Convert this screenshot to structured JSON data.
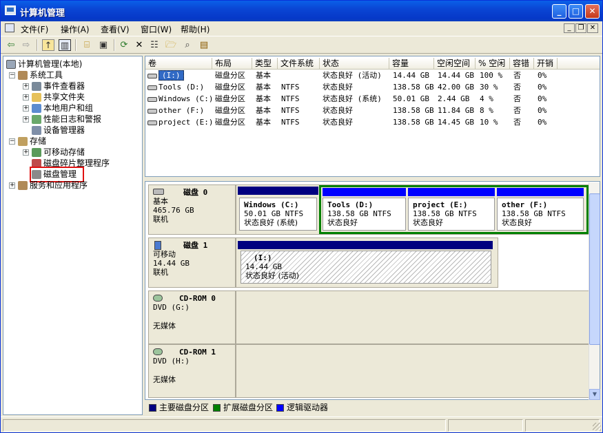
{
  "window": {
    "title": "计算机管理"
  },
  "menu": [
    "文件(F)",
    "操作(A)",
    "查看(V)",
    "窗口(W)",
    "帮助(H)"
  ],
  "toolbar": {
    "icons": [
      "back-icon",
      "forward-icon",
      "up-icon",
      "show-hide-tree-icon",
      "properties-icon",
      "help-icon",
      "refresh-icon",
      "delete-icon",
      "properties2-icon",
      "open-icon",
      "search-icon",
      "export-icon"
    ]
  },
  "tree": {
    "root": "计算机管理(本地)",
    "system_tools": "系统工具",
    "event_viewer": "事件查看器",
    "shared_folders": "共享文件夹",
    "local_users": "本地用户和组",
    "perf_logs": "性能日志和警报",
    "device_manager": "设备管理器",
    "storage": "存储",
    "removable_storage": "可移动存储",
    "defrag": "磁盘碎片整理程序",
    "disk_management": "磁盘管理",
    "services": "服务和应用程序"
  },
  "volumes": {
    "columns": [
      "卷",
      "布局",
      "类型",
      "文件系统",
      "状态",
      "容量",
      "空闲空间",
      "% 空闲",
      "容错",
      "开销"
    ],
    "rows": [
      {
        "vol": "(I:)",
        "layout": "磁盘分区",
        "type": "基本",
        "fs": "",
        "status": "状态良好 (活动)",
        "cap": "14.44 GB",
        "free": "14.44 GB",
        "pct": "100 %",
        "ft": "否",
        "ovh": "0%"
      },
      {
        "vol": "Tools (D:)",
        "layout": "磁盘分区",
        "type": "基本",
        "fs": "NTFS",
        "status": "状态良好",
        "cap": "138.58 GB",
        "free": "42.00 GB",
        "pct": "30 %",
        "ft": "否",
        "ovh": "0%"
      },
      {
        "vol": "Windows (C:)",
        "layout": "磁盘分区",
        "type": "基本",
        "fs": "NTFS",
        "status": "状态良好 (系统)",
        "cap": "50.01 GB",
        "free": "2.44 GB",
        "pct": "4 %",
        "ft": "否",
        "ovh": "0%"
      },
      {
        "vol": "other (F:)",
        "layout": "磁盘分区",
        "type": "基本",
        "fs": "NTFS",
        "status": "状态良好",
        "cap": "138.58 GB",
        "free": "11.84 GB",
        "pct": "8 %",
        "ft": "否",
        "ovh": "0%"
      },
      {
        "vol": "project (E:)",
        "layout": "磁盘分区",
        "type": "基本",
        "fs": "NTFS",
        "status": "状态良好",
        "cap": "138.58 GB",
        "free": "14.45 GB",
        "pct": "10 %",
        "ft": "否",
        "ovh": "0%"
      }
    ]
  },
  "disks": {
    "disk0": {
      "name": "磁盘 0",
      "type": "基本",
      "size": "465.76 GB",
      "state": "联机",
      "parts": [
        {
          "name": "Windows  (C:)",
          "info": "50.01 GB NTFS",
          "status": "状态良好 (系统)"
        },
        {
          "name": "Tools  (D:)",
          "info": "138.58 GB NTFS",
          "status": "状态良好"
        },
        {
          "name": "project  (E:)",
          "info": "138.58 GB NTFS",
          "status": "状态良好"
        },
        {
          "name": "other  (F:)",
          "info": "138.58 GB NTFS",
          "status": "状态良好"
        }
      ]
    },
    "disk1": {
      "name": "磁盘 1",
      "type": "可移动",
      "size": "14.44 GB",
      "state": "联机",
      "part": {
        "name": "(I:)",
        "info": "14.44 GB",
        "status": "状态良好 (活动)"
      }
    },
    "cdrom0": {
      "name": "CD-ROM 0",
      "drive": "DVD (G:)",
      "media": "无媒体"
    },
    "cdrom1": {
      "name": "CD-ROM 1",
      "drive": "DVD (H:)",
      "media": "无媒体"
    }
  },
  "legend": {
    "primary": "主要磁盘分区",
    "extended": "扩展磁盘分区",
    "logical": "逻辑驱动器"
  },
  "colors": {
    "primary": "#000080",
    "extended": "#008000",
    "logical": "#0000ff",
    "titlebar": "#0a46d4",
    "highlight": "#e01010"
  }
}
